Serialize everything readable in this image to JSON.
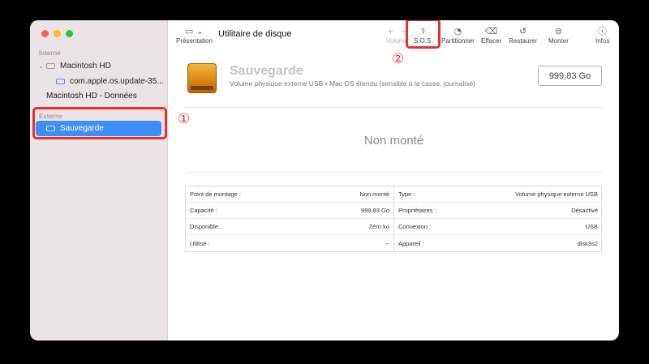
{
  "window": {
    "title": "Utilitaire de disque"
  },
  "toolbar": {
    "presentation": "Présentation",
    "volume": "Volume",
    "sos": "S.O.S.",
    "partition": "Partitionner",
    "erase": "Effacer",
    "restore": "Restaurer",
    "mount": "Monter",
    "info": "Infos",
    "add_glyph": "+",
    "remove_glyph": "−"
  },
  "sidebar": {
    "internal_label": "Interne",
    "items": [
      {
        "label": "Macintosh HD"
      },
      {
        "label": "com.apple.os.update-35..."
      },
      {
        "label": "Macintosh HD - Données"
      }
    ],
    "external_label": "Externe",
    "selected": "Sauvegarde"
  },
  "annotations": {
    "one": "①",
    "two": "②"
  },
  "disk": {
    "name": "Sauvegarde",
    "description": "Volume physique externe USB • Mac OS étendu (sensible à la casse, journalisé)",
    "size": "999,83 Go",
    "status": "Non monté"
  },
  "info": {
    "left": [
      {
        "key": "Point de montage :",
        "value": "Non monté"
      },
      {
        "key": "Capacité :",
        "value": "999,83 Go"
      },
      {
        "key": "Disponible :",
        "value": "Zéro ko"
      },
      {
        "key": "Utilisé :",
        "value": "--"
      }
    ],
    "right": [
      {
        "key": "Type :",
        "value": "Volume physique externe USB"
      },
      {
        "key": "Propriétaires :",
        "value": "Désactivé"
      },
      {
        "key": "Connexion :",
        "value": "USB"
      },
      {
        "key": "Appareil :",
        "value": "disk3s2"
      }
    ]
  },
  "colors": {
    "selection": "#3d8ef7",
    "highlight": "#e8312f",
    "sidebar_bg": "#ebe4e6"
  }
}
